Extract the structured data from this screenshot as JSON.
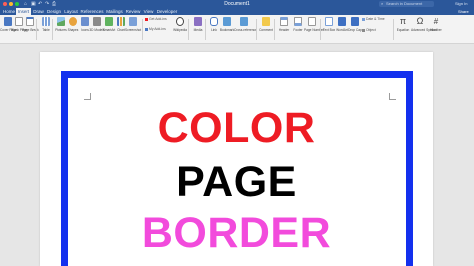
{
  "window": {
    "title": "Document1",
    "search_placeholder": "Search in Document",
    "sign_in": "Sign In",
    "share": "Share"
  },
  "tabs": [
    {
      "label": "Home",
      "active": false
    },
    {
      "label": "Insert",
      "active": true
    },
    {
      "label": "Draw",
      "active": false
    },
    {
      "label": "Design",
      "active": false
    },
    {
      "label": "Layout",
      "active": false
    },
    {
      "label": "References",
      "active": false
    },
    {
      "label": "Mailings",
      "active": false
    },
    {
      "label": "Review",
      "active": false
    },
    {
      "label": "View",
      "active": false
    },
    {
      "label": "Developer",
      "active": false
    }
  ],
  "ribbon": {
    "buttons": [
      {
        "label": "Cover Page",
        "icon": "cover-page-icon",
        "color": "#4a78c2"
      },
      {
        "label": "Blank Page",
        "icon": "blank-page-icon",
        "color": "#ffffff"
      },
      {
        "label": "Page Break",
        "icon": "page-break-icon",
        "color": "#ffffff"
      },
      {
        "label": "Table",
        "icon": "table-icon",
        "color": "#7aa0d8"
      },
      {
        "label": "Pictures",
        "icon": "pictures-icon",
        "color": "#5fa85f"
      },
      {
        "label": "Shapes",
        "icon": "shapes-icon",
        "color": "#e8a33d"
      },
      {
        "label": "Icons",
        "icon": "icons-icon",
        "color": "#6b8fcf"
      },
      {
        "label": "3D Models",
        "icon": "3d-models-icon",
        "color": "#8a8a8a"
      },
      {
        "label": "SmartArt",
        "icon": "smartart-icon",
        "color": "#5fb35f"
      },
      {
        "label": "Chart",
        "icon": "chart-icon",
        "color": "#4a78c2"
      },
      {
        "label": "Screenshot",
        "icon": "screenshot-icon",
        "color": "#7aa0d8"
      },
      {
        "label": "Wikipedia",
        "icon": "wikipedia-icon",
        "color": "#444444"
      },
      {
        "label": "Media",
        "icon": "media-icon",
        "color": "#8a6fc2"
      },
      {
        "label": "Link",
        "icon": "link-icon",
        "color": "#4a78c2"
      },
      {
        "label": "Bookmark",
        "icon": "bookmark-icon",
        "color": "#5b9bd5"
      },
      {
        "label": "Cross-reference",
        "icon": "cross-reference-icon",
        "color": "#5b9bd5"
      },
      {
        "label": "Comment",
        "icon": "comment-icon",
        "color": "#f2c94c"
      },
      {
        "label": "Header",
        "icon": "header-icon",
        "color": "#7aa0d8"
      },
      {
        "label": "Footer",
        "icon": "footer-icon",
        "color": "#7aa0d8"
      },
      {
        "label": "Page Number",
        "icon": "page-number-icon",
        "color": "#7aa0d8"
      },
      {
        "label": "Text Box",
        "icon": "text-box-icon",
        "color": "#7aa0d8"
      },
      {
        "label": "WordArt",
        "icon": "wordart-icon",
        "color": "#3d6fc2"
      },
      {
        "label": "Drop Cap",
        "icon": "drop-cap-icon",
        "color": "#3d6fc2"
      },
      {
        "label": "Equation",
        "icon": "equation-icon",
        "color": "#444444"
      },
      {
        "label": "Advanced Symbol",
        "icon": "omega-icon",
        "color": "#444444"
      },
      {
        "label": "Number",
        "icon": "number-icon",
        "color": "#444444"
      }
    ],
    "addins": {
      "store": "Get Add-ins",
      "my_addins": "My Add-ins"
    },
    "text_group": {
      "date_time": "Date & Time",
      "object": "Object"
    }
  },
  "document": {
    "lines": [
      {
        "text": "COLOR",
        "color": "#ee1c24"
      },
      {
        "text": "PAGE",
        "color": "#000000"
      },
      {
        "text": "BORDER",
        "color": "#f24bdc"
      }
    ],
    "page_border_color": "#1330ee"
  }
}
